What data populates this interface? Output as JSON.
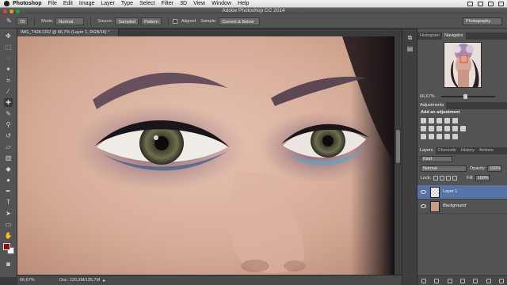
{
  "menubar": {
    "app": "Photoshop",
    "items": [
      "File",
      "Edit",
      "Image",
      "Layer",
      "Type",
      "Select",
      "Filter",
      "3D",
      "View",
      "Window",
      "Help"
    ]
  },
  "titlebar": {
    "title": "Adobe Photoshop CC 2014"
  },
  "options": {
    "brush_size": "70",
    "mode_label": "Mode:",
    "mode_value": "Normal",
    "source_label": "Source:",
    "source_sampled": "Sampled",
    "source_pattern": "Pattern",
    "aligned_label": "Aligned",
    "sample_label": "Sample:",
    "sample_value": "Current & Below",
    "workspace": "Photography"
  },
  "document": {
    "tab_title": "IMG_7428.CR2 @ 66,7% (Layer 1, RGB/16) *"
  },
  "status": {
    "zoom": "66,67%",
    "doc": "Doc: 120,3M/135,7M"
  },
  "navigator": {
    "tabs": [
      "Histogram",
      "Navigator"
    ],
    "zoom": "66,67%"
  },
  "adjustments": {
    "tab": "Adjustments",
    "title": "Add an adjustment"
  },
  "layers": {
    "tabs": [
      "Layers",
      "Channels",
      "History",
      "Actions"
    ],
    "filter": "Kind",
    "blend": "Normal",
    "opacity_label": "Opacity:",
    "opacity": "100%",
    "lock_label": "Lock:",
    "fill_label": "Fill:",
    "fill": "100%",
    "items": [
      {
        "name": "Layer 1",
        "selected": true
      },
      {
        "name": "Background",
        "selected": false
      }
    ]
  },
  "colors": {
    "foreground": "#8b1010",
    "background": "#ffffff",
    "selection": "#5873a6"
  }
}
